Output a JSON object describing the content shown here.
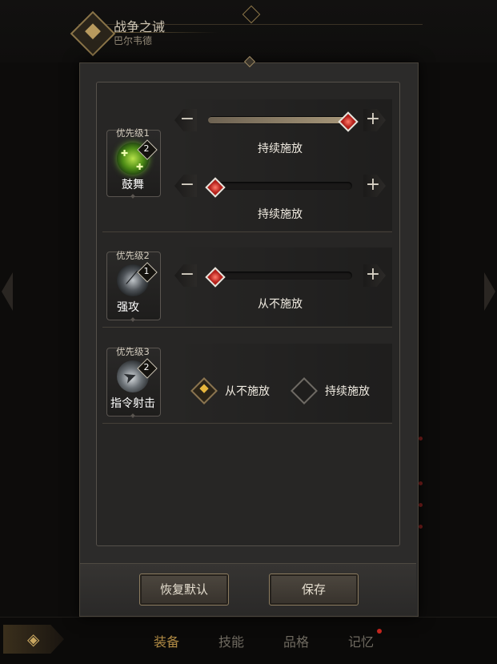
{
  "hero": {
    "title": "战争之诫",
    "subtitle": "巴尔韦德"
  },
  "rows": [
    {
      "priority": "优先级1",
      "skill_name": "鼓舞",
      "level": "2",
      "sliders": [
        {
          "level": 1.0,
          "label": "持续施放"
        },
        {
          "level": 0.0,
          "label": "持续施放"
        }
      ]
    },
    {
      "priority": "优先级2",
      "skill_name": "强攻",
      "level": "1",
      "sliders": [
        {
          "level": 0.0,
          "label": "从不施放"
        }
      ]
    },
    {
      "priority": "优先级3",
      "skill_name": "指令射击",
      "level": "2",
      "options": [
        {
          "label": "从不施放",
          "selected": true
        },
        {
          "label": "持续施放",
          "selected": false
        }
      ]
    }
  ],
  "buttons": {
    "reset": "恢复默认",
    "save": "保存"
  },
  "bottom_tabs": [
    {
      "label": "装备",
      "active": true
    },
    {
      "label": "技能",
      "active": false
    },
    {
      "label": "品格",
      "active": false
    },
    {
      "label": "记忆",
      "active": false,
      "badge": true
    }
  ],
  "slider_symbols": {
    "minus": "−",
    "plus": "+"
  },
  "colors": {
    "accent_gold": "#e7b63d",
    "knob_red": "#b5221c",
    "badge_red": "#c8261f"
  }
}
